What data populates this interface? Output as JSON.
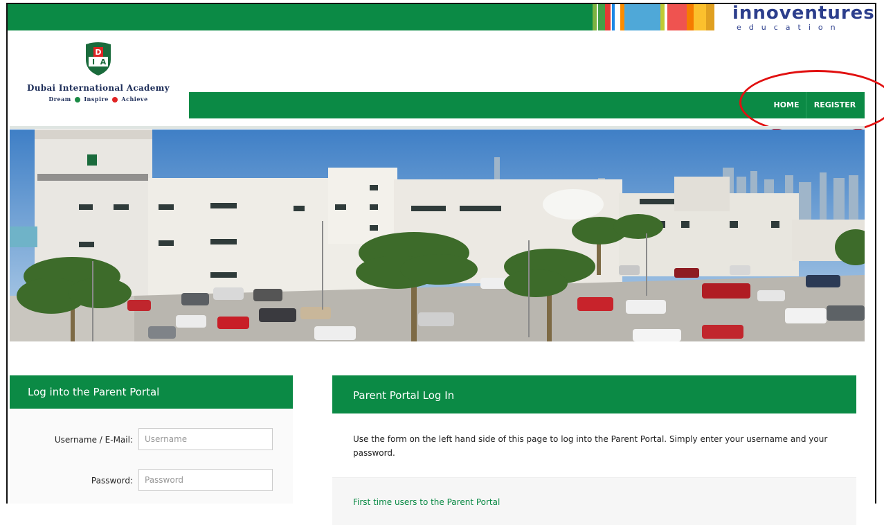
{
  "brand": {
    "innoventures_word": "innoventures",
    "innoventures_sub": "education",
    "academy_name": "Dubai International Academy",
    "academy_tag": [
      "Dream",
      "Inspire",
      "Achieve"
    ],
    "shield_letters": [
      "D",
      "I",
      "A"
    ]
  },
  "nav": {
    "home_label": "HOME",
    "register_label": "REGISTER"
  },
  "hero": {
    "building_sign": "Dubai International Academy"
  },
  "login_panel": {
    "title": "Log into the Parent Portal",
    "username_label": "Username / E-Mail:",
    "username_placeholder": "Username",
    "password_label": "Password:",
    "password_placeholder": "Password"
  },
  "info_panel": {
    "title": "Parent Portal Log In",
    "intro_text": "Use the form on the left hand side of this page to log into the Parent Portal. Simply enter your username and your password.",
    "first_time_link": "First time users to the Parent Portal"
  },
  "colors": {
    "brand_green": "#0b8a45",
    "navy": "#2c3e8c",
    "annotation_red": "#e11010",
    "strip_colors": [
      "#8bc34a",
      "#e53935",
      "#1e88e5",
      "#4fc3f7",
      "#ff7043",
      "#ffca28",
      "#f4511e",
      "#fdd835"
    ]
  }
}
